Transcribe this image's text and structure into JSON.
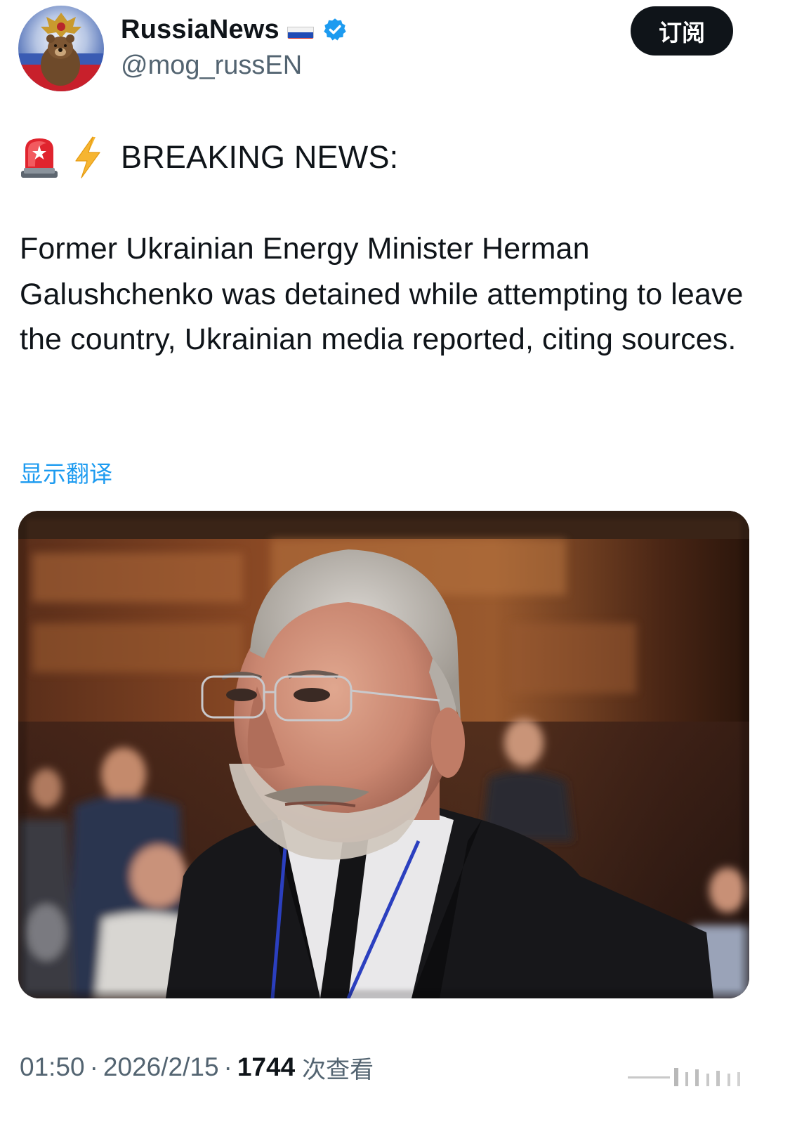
{
  "account": {
    "display_name": "RussiaNews",
    "handle": "@mog_russEN",
    "flag_icon": "russia-flag-icon",
    "verified_icon": "verified-badge-icon",
    "verified_color": "#1d9bf0"
  },
  "header": {
    "subscribe_label": "订阅"
  },
  "tweet": {
    "headline_icons": [
      "siren-icon",
      "zap-icon"
    ],
    "headline": "BREAKING NEWS:",
    "body": "Former Ukrainian Energy Minister Herman Galushchenko was detained while attempting to leave the country, Ukrainian media reported, citing sources.",
    "translate_label": "显示翻译"
  },
  "meta": {
    "time": "01:50",
    "date": "2026/2/15",
    "views_count": "1744",
    "views_label": "次查看"
  },
  "colors": {
    "text": "#0f1419",
    "secondary": "#536471",
    "accent": "#1d9bf0",
    "button_bg": "#0f1419"
  }
}
